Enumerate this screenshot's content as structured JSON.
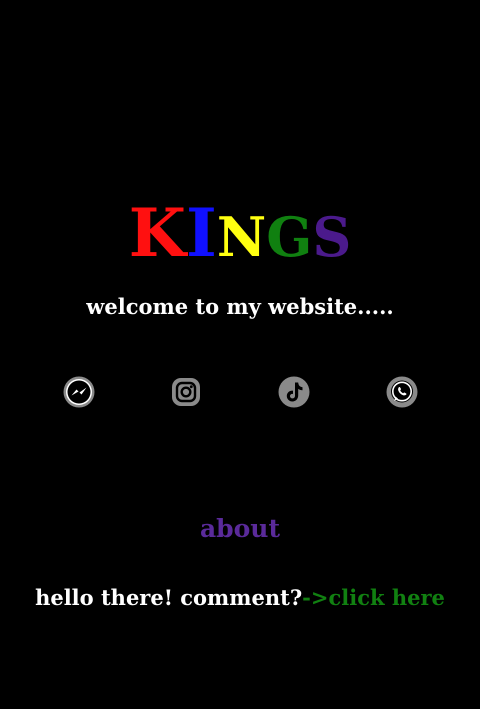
{
  "logo": {
    "letters": [
      {
        "char": "K",
        "color": "#ff1010"
      },
      {
        "char": "I",
        "color": "#1010ff"
      },
      {
        "char": "N",
        "color": "#ffff10"
      },
      {
        "char": "G",
        "color": "#108010"
      },
      {
        "char": "S",
        "color": "#4b1a8c"
      }
    ]
  },
  "welcome_text": "welcome to my website.....",
  "socials": [
    {
      "name": "messenger-icon"
    },
    {
      "name": "instagram-icon"
    },
    {
      "name": "tiktok-icon"
    },
    {
      "name": "whatsapp-icon"
    }
  ],
  "about": {
    "label": "about",
    "color": "#5a2a9a"
  },
  "comment": {
    "prompt": "hello there! comment?",
    "arrow": "->",
    "link": "click here",
    "link_color": "#118011"
  }
}
